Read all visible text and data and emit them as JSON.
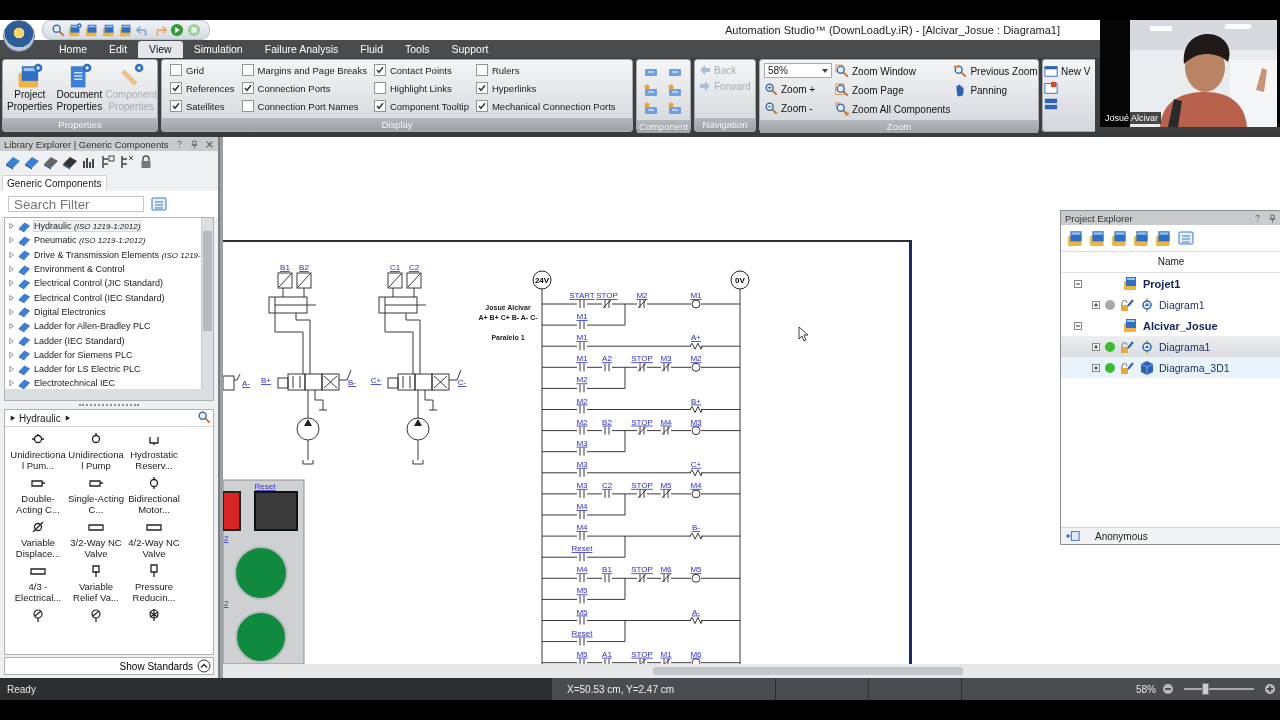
{
  "title_bar": {
    "title": "Automation Studio™ (DownLoadLy.iR) - [Alcivar_Josue : Diagrama1]"
  },
  "webcam": {
    "kind": "picture",
    "name": "Josué Alcivar"
  },
  "ribbon": {
    "tabs": [
      {
        "label": "Home",
        "selected": false
      },
      {
        "label": "Edit",
        "selected": false
      },
      {
        "label": "View",
        "selected": true
      },
      {
        "label": "Simulation",
        "selected": false
      },
      {
        "label": "Failure Analysis",
        "selected": false
      },
      {
        "label": "Fluid",
        "selected": false
      },
      {
        "label": "Tools",
        "selected": false
      },
      {
        "label": "Support",
        "selected": false
      }
    ],
    "properties": {
      "label": "Properties",
      "buttons": [
        {
          "label": "Project Properties",
          "disabled": false
        },
        {
          "label": "Document Properties",
          "disabled": false
        },
        {
          "label": "Component Properties",
          "disabled": true
        }
      ]
    },
    "display": {
      "label": "Display",
      "columns": [
        [
          {
            "label": "Grid",
            "checked": false
          },
          {
            "label": "References",
            "checked": true
          },
          {
            "label": "Satellites",
            "checked": true
          }
        ],
        [
          {
            "label": "Margins and Page Breaks",
            "checked": false
          },
          {
            "label": "Connection Ports",
            "checked": true
          },
          {
            "label": "Connection Port Names",
            "checked": false
          }
        ],
        [
          {
            "label": "Contact Points",
            "checked": true
          },
          {
            "label": "Highlight Links",
            "checked": false
          },
          {
            "label": "Component Tooltip",
            "checked": true
          }
        ],
        [
          {
            "label": "Rulers",
            "checked": false
          },
          {
            "label": "Hyperlinks",
            "checked": true
          },
          {
            "label": "Mechanical Connection Ports",
            "checked": true
          }
        ]
      ]
    },
    "component": {
      "label": "Component"
    },
    "navigation": {
      "label": "Navigation",
      "buttons": [
        {
          "label": "Back",
          "disabled": true
        },
        {
          "label": "Forward",
          "disabled": true
        }
      ]
    },
    "zoom": {
      "label": "Zoom",
      "value": "58%",
      "columns": [
        [
          {
            "label": "Zoom +",
            "kind": "zoom-in"
          },
          {
            "label": "Zoom -",
            "kind": "zoom-out"
          }
        ],
        [
          {
            "label": "Zoom Window",
            "kind": "zoom-window"
          },
          {
            "label": "Zoom Page",
            "kind": "zoom-page"
          },
          {
            "label": "Zoom All Components",
            "kind": "zoom-all"
          }
        ],
        [
          {
            "label": "Previous Zoom",
            "kind": "previous"
          },
          {
            "label": "Panning",
            "kind": "pan"
          }
        ]
      ]
    },
    "window": {
      "buttons": [
        {
          "label": "New V"
        }
      ]
    }
  },
  "library": {
    "title": "Library Explorer | Generic Components",
    "tab": "Generic Components",
    "search": {
      "placeholder": "Search Filter"
    },
    "libraries": [
      {
        "name": "Hydraulic",
        "note": "(ISO 1219-1:2012)",
        "selected": true
      },
      {
        "name": "Pneumatic",
        "note": "(ISO 1219-1:2012)",
        "selected": false
      },
      {
        "name": "Drive & Transmission Elements",
        "note": "(ISO 1219-",
        "selected": false
      },
      {
        "name": "Environment & Control",
        "selected": false
      },
      {
        "name": "Electrical Control (JIC Standard)",
        "selected": false
      },
      {
        "name": "Electrical Control (IEC Standard)",
        "selected": false
      },
      {
        "name": "Digital Electronics",
        "selected": false
      },
      {
        "name": "Ladder for Allen-Bradley PLC",
        "selected": false
      },
      {
        "name": "Ladder (IEC Standard)",
        "selected": false
      },
      {
        "name": "Ladder for Siemens PLC",
        "selected": false
      },
      {
        "name": "Ladder for LS Electric PLC",
        "selected": false
      },
      {
        "name": "Electrotechnical IEC",
        "selected": false
      }
    ],
    "breadcrumb": "Hydraulic",
    "components": [
      {
        "label": "Unidirectional Pum..."
      },
      {
        "label": "Unidirectional Pump"
      },
      {
        "label": "Hydrostatic Reserv..."
      },
      {
        "label": "Double-Acting C..."
      },
      {
        "label": "Single-Acting C..."
      },
      {
        "label": "Bidirectional Motor..."
      },
      {
        "label": "Variable Displace..."
      },
      {
        "label": "3/2-Way NC Valve"
      },
      {
        "label": "4/2-Way NC Valve"
      },
      {
        "label": "4/3 - Electrical..."
      },
      {
        "label": "Variable Relief Va..."
      },
      {
        "label": "Pressure Reducin..."
      }
    ],
    "show_standards": "Show Standards"
  },
  "diagram": {
    "left_label": "A-",
    "units": [
      {
        "sensors": [
          "B1",
          "B2"
        ],
        "plus": "B+",
        "minus": "B-"
      },
      {
        "sensors": [
          "C1",
          "C2"
        ],
        "plus": "C+",
        "minus": "C-"
      }
    ],
    "note": [
      "Josué Alcivar",
      "A+ B+ C+ B- A- C-",
      "Paralelo 1"
    ],
    "panel": {
      "button_label": "Reset",
      "side_labels": [
        "2",
        "2"
      ]
    },
    "ladder": {
      "left_rail": "24V",
      "right_rail": "0V",
      "rungs": [
        {
          "kind": "main",
          "elements": [
            {
              "kind": "no",
              "label": "START"
            },
            {
              "kind": "nc",
              "label": "STOP"
            },
            {
              "kind": "nc",
              "label": "M2"
            },
            {
              "kind": "coil",
              "label": "M1"
            }
          ]
        },
        {
          "kind": "branch",
          "elements": [
            {
              "kind": "no",
              "label": "M1"
            }
          ]
        },
        {
          "kind": "main",
          "elements": [
            {
              "kind": "no",
              "label": "M1"
            },
            {
              "kind": "solenoid",
              "label": "A+"
            }
          ]
        },
        {
          "kind": "main",
          "elements": [
            {
              "kind": "no",
              "label": "M1"
            },
            {
              "kind": "no",
              "label": "A2"
            },
            {
              "kind": "nc",
              "label": "STOP"
            },
            {
              "kind": "nc",
              "label": "M3"
            },
            {
              "kind": "coil",
              "label": "M2"
            }
          ]
        },
        {
          "kind": "branch",
          "elements": [
            {
              "kind": "no",
              "label": "M2"
            }
          ]
        },
        {
          "kind": "main",
          "elements": [
            {
              "kind": "no",
              "label": "M2"
            },
            {
              "kind": "solenoid",
              "label": "B+"
            }
          ]
        },
        {
          "kind": "main",
          "elements": [
            {
              "kind": "no",
              "label": "M2"
            },
            {
              "kind": "no",
              "label": "B2"
            },
            {
              "kind": "nc",
              "label": "STOP"
            },
            {
              "kind": "nc",
              "label": "M4"
            },
            {
              "kind": "coil",
              "label": "M3"
            }
          ]
        },
        {
          "kind": "branch",
          "elements": [
            {
              "kind": "no",
              "label": "M3"
            }
          ]
        },
        {
          "kind": "main",
          "elements": [
            {
              "kind": "no",
              "label": "M3"
            },
            {
              "kind": "solenoid",
              "label": "C+"
            }
          ]
        },
        {
          "kind": "main",
          "elements": [
            {
              "kind": "no",
              "label": "M3"
            },
            {
              "kind": "no",
              "label": "C2"
            },
            {
              "kind": "nc",
              "label": "STOP"
            },
            {
              "kind": "nc",
              "label": "M5"
            },
            {
              "kind": "coil",
              "label": "M4"
            }
          ]
        },
        {
          "kind": "branch",
          "elements": [
            {
              "kind": "no",
              "label": "M4"
            }
          ]
        },
        {
          "kind": "main",
          "elements": [
            {
              "kind": "no",
              "label": "M4"
            },
            {
              "kind": "solenoid",
              "label": "B-"
            }
          ]
        },
        {
          "kind": "branch",
          "elements": [
            {
              "kind": "no",
              "label": "Reset"
            }
          ]
        },
        {
          "kind": "main",
          "elements": [
            {
              "kind": "no",
              "label": "M4"
            },
            {
              "kind": "no",
              "label": "B1"
            },
            {
              "kind": "nc",
              "label": "STOP"
            },
            {
              "kind": "nc",
              "label": "M6"
            },
            {
              "kind": "coil",
              "label": "M5"
            }
          ]
        },
        {
          "kind": "branch",
          "elements": [
            {
              "kind": "no",
              "label": "M5"
            }
          ]
        },
        {
          "kind": "main",
          "elements": [
            {
              "kind": "no",
              "label": "M5"
            },
            {
              "kind": "solenoid",
              "label": "A-"
            }
          ]
        },
        {
          "kind": "branch",
          "elements": [
            {
              "kind": "no",
              "label": "Reset"
            }
          ]
        },
        {
          "kind": "main",
          "elements": [
            {
              "kind": "no",
              "label": "M5"
            },
            {
              "kind": "no",
              "label": "A1"
            },
            {
              "kind": "nc",
              "label": "STOP"
            },
            {
              "kind": "nc",
              "label": "M1"
            },
            {
              "kind": "coil",
              "label": "M6"
            }
          ]
        }
      ]
    }
  },
  "project_explorer": {
    "title": "Project Explorer",
    "column": "Name",
    "projects": [
      {
        "name": "Projet1",
        "expanded": true,
        "children": [
          {
            "name": "Diagram1",
            "kind": "diagram",
            "color": "#a9a9a9",
            "expanded": false,
            "selected": false,
            "hovered": false
          }
        ]
      },
      {
        "name": "Alcivar_Josue",
        "expanded": true,
        "children": [
          {
            "name": "Diagrama1",
            "kind": "diagram",
            "color": "#3dbb2e",
            "expanded": false,
            "selected": true,
            "hovered": false
          },
          {
            "name": "Diagrama_3D1",
            "kind": "model",
            "color": "#3dbb2e",
            "expanded": false,
            "selected": false,
            "hovered": true
          }
        ]
      }
    ],
    "user": "Anonymous"
  },
  "status_bar": {
    "status": "Ready",
    "coordinates": "X=50.53 cm, Y=2.47 cm",
    "zoom": "58%",
    "zoom_slider": {
      "level": 0.3
    }
  }
}
